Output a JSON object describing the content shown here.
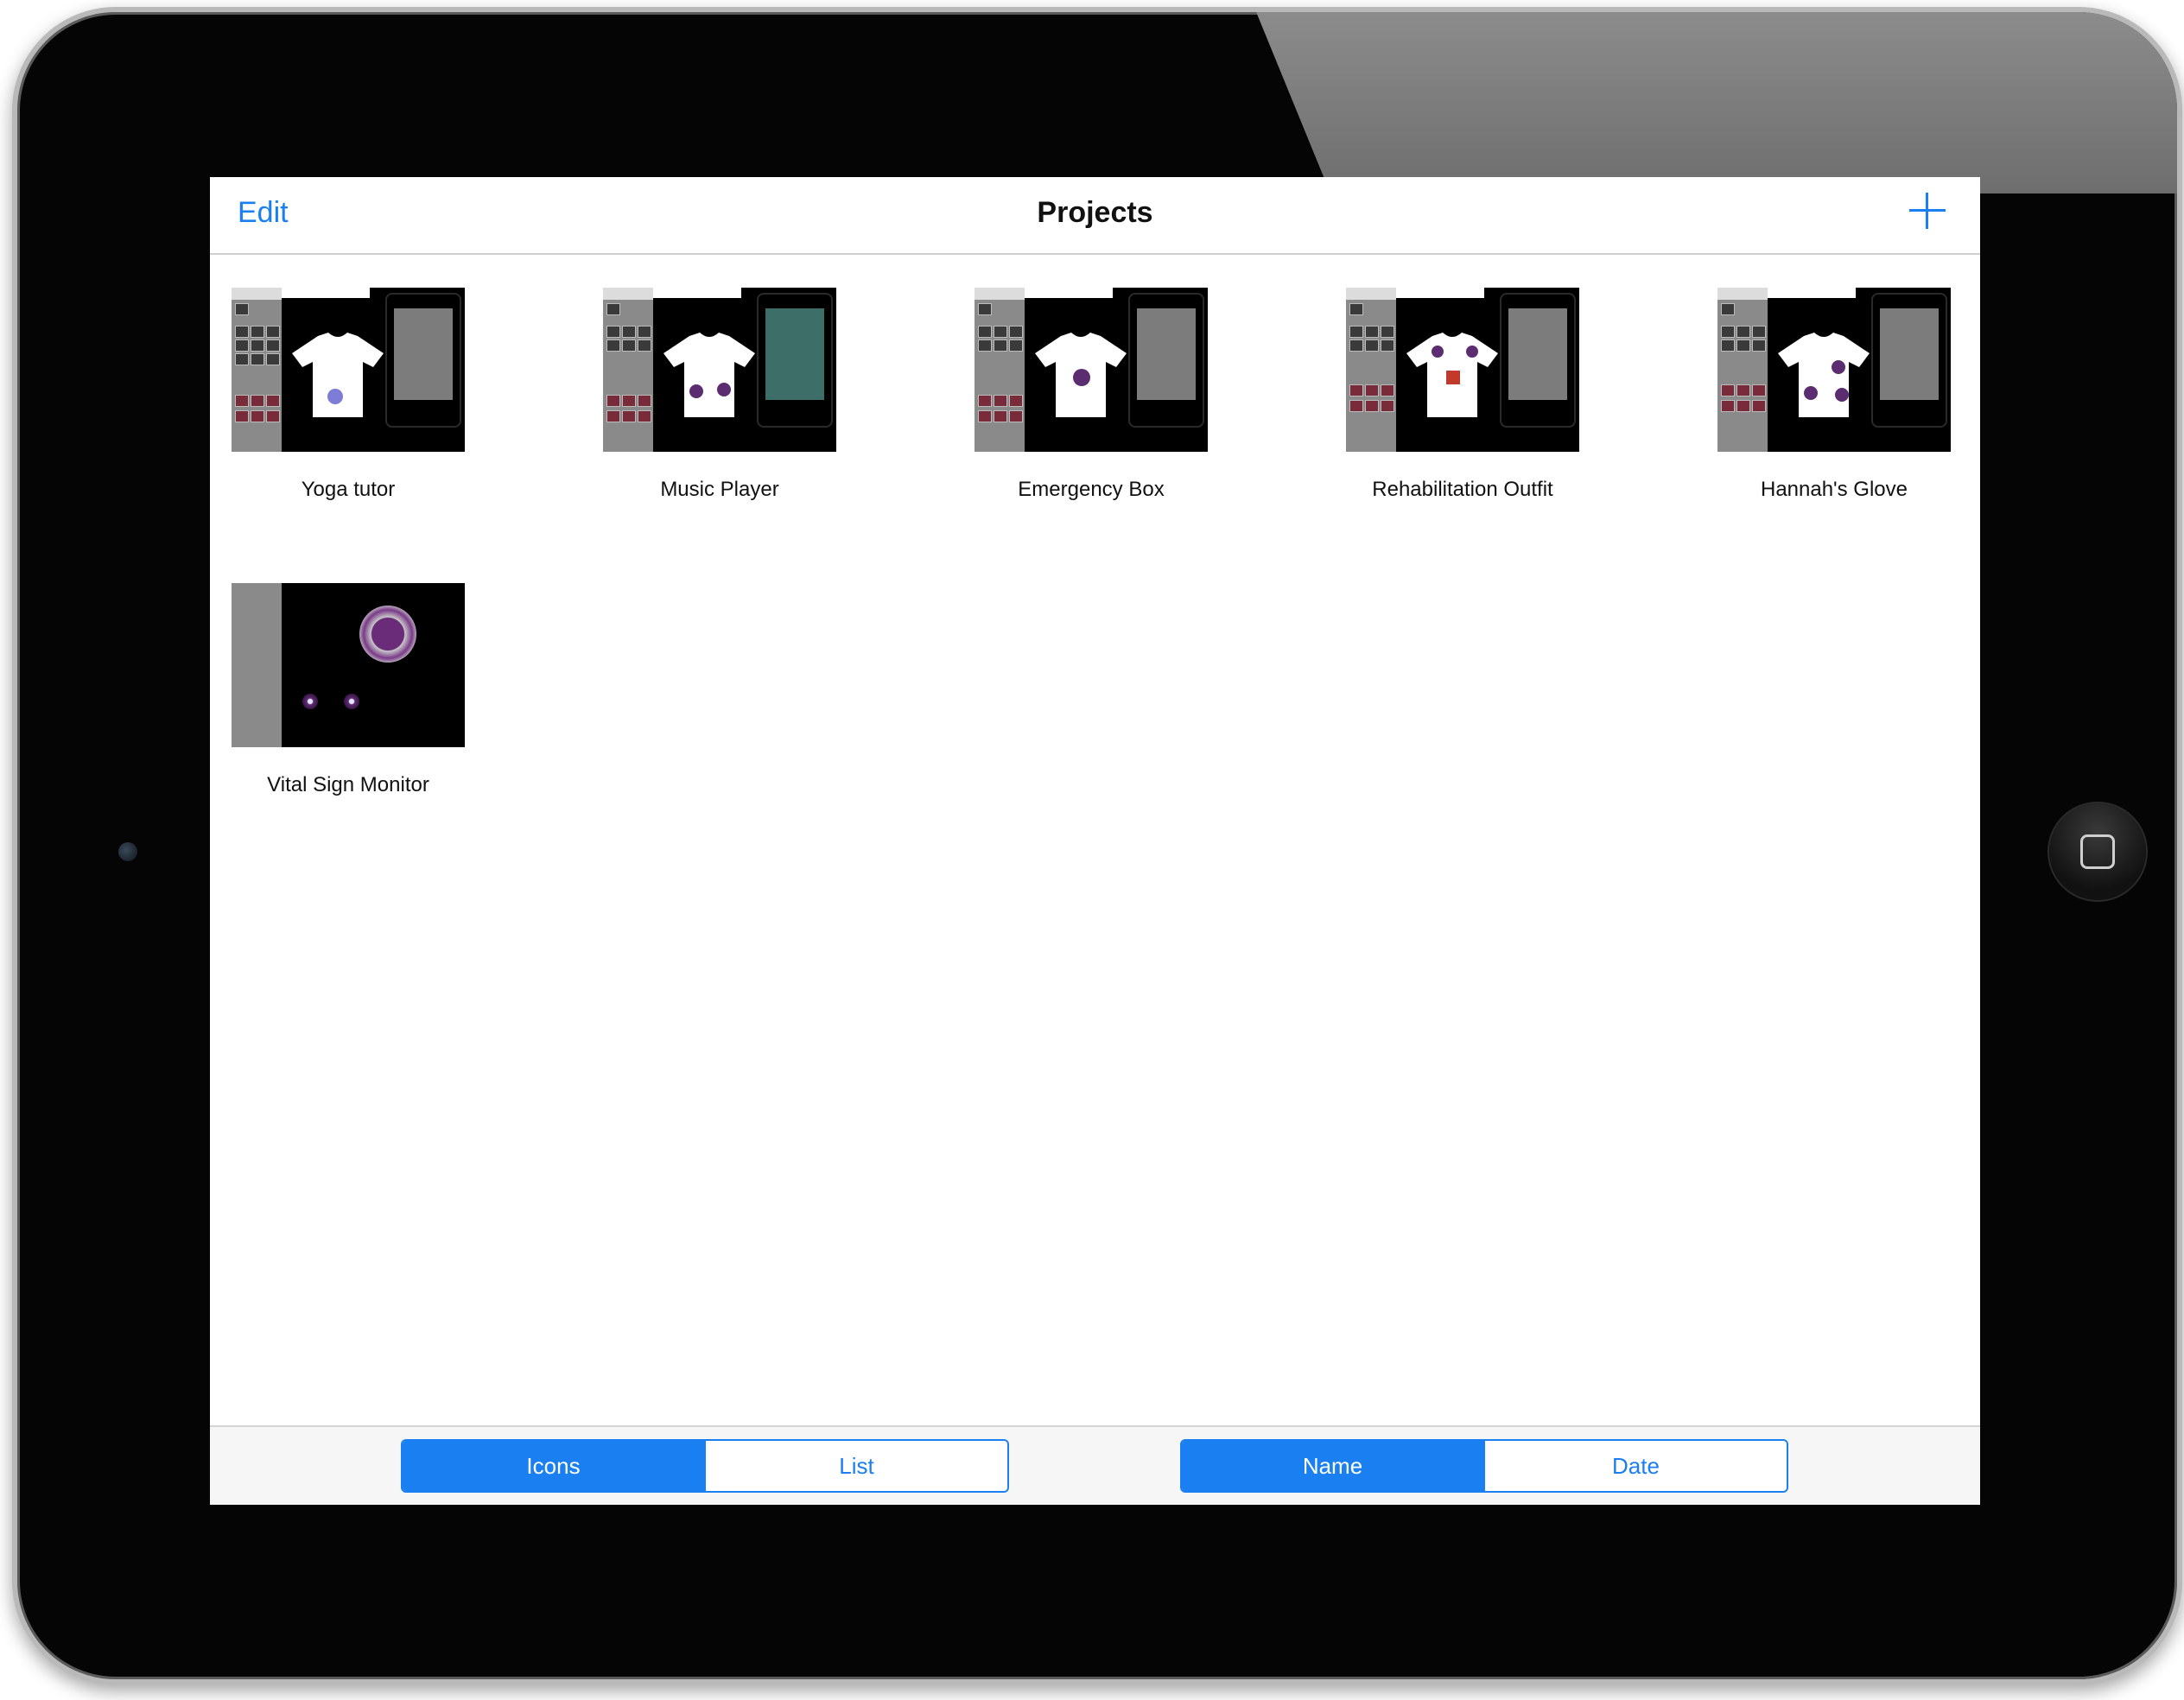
{
  "navbar": {
    "edit_label": "Edit",
    "title": "Projects",
    "add_icon": "plus-icon"
  },
  "projects": [
    {
      "name": "Yoga tutor"
    },
    {
      "name": "Music Player"
    },
    {
      "name": "Emergency Box"
    },
    {
      "name": "Rehabilitation Outfit"
    },
    {
      "name": "Hannah's Glove"
    },
    {
      "name": "Vital Sign Monitor"
    }
  ],
  "bottombar": {
    "view_toggle": {
      "options": [
        "Icons",
        "List"
      ],
      "selected": "Icons"
    },
    "sort_toggle": {
      "options": [
        "Name",
        "Date"
      ],
      "selected": "Name"
    }
  },
  "colors": {
    "accent": "#1a7ff0",
    "bezel": "#050505",
    "thumbnail_bg": "#000000"
  },
  "device": {
    "home_button_icon": "home-square-icon",
    "camera_icon": "front-camera-icon"
  }
}
